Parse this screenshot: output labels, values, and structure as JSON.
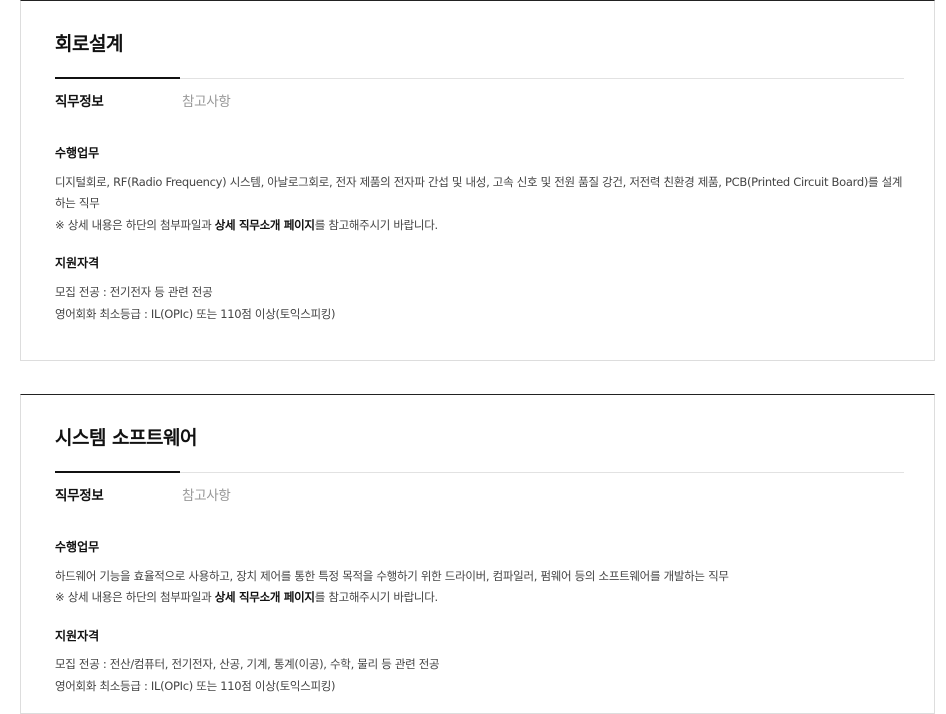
{
  "cards": [
    {
      "title": "회로설계",
      "tabs": {
        "active": "직무정보",
        "inactive": "참고사항"
      },
      "duties_heading": "수행업무",
      "duties_text": "디지털회로, RF(Radio Frequency) 시스템, 아날로그회로, 전자 제품의 전자파 간섭 및 내성, 고속 신호 및 전원 품질 강건, 저전력 친환경 제품, PCB(Printed Circuit Board)를 설계하는 직무",
      "note_prefix": "※ 상세 내용은 하단의 첨부파일과 ",
      "note_link": "상세 직무소개 페이지",
      "note_suffix": "를 참고해주시기 바랍니다.",
      "qual_heading": "지원자격",
      "qual_major": "모집 전공 : 전기전자 등 관련 전공",
      "qual_english": "영어회화 최소등급 : IL(OPIc) 또는 110점 이상(토익스피킹)"
    },
    {
      "title": "시스템 소프트웨어",
      "tabs": {
        "active": "직무정보",
        "inactive": "참고사항"
      },
      "duties_heading": "수행업무",
      "duties_text": "하드웨어 기능을 효율적으로 사용하고, 장치 제어를 통한 특정 목적을 수행하기 위한 드라이버, 컴파일러, 펌웨어 등의 소프트웨어를 개발하는 직무",
      "note_prefix": "※ 상세 내용은 하단의 첨부파일과 ",
      "note_link": "상세 직무소개 페이지",
      "note_suffix": "를 참고해주시기 바랍니다.",
      "qual_heading": "지원자격",
      "qual_major": "모집 전공 : 전산/컴퓨터, 전기전자, 산공, 기계, 통계(이공), 수학, 물리 등 관련 전공",
      "qual_english": "영어회화 최소등급 : IL(OPIc) 또는 110점 이상(토익스피킹)"
    }
  ]
}
